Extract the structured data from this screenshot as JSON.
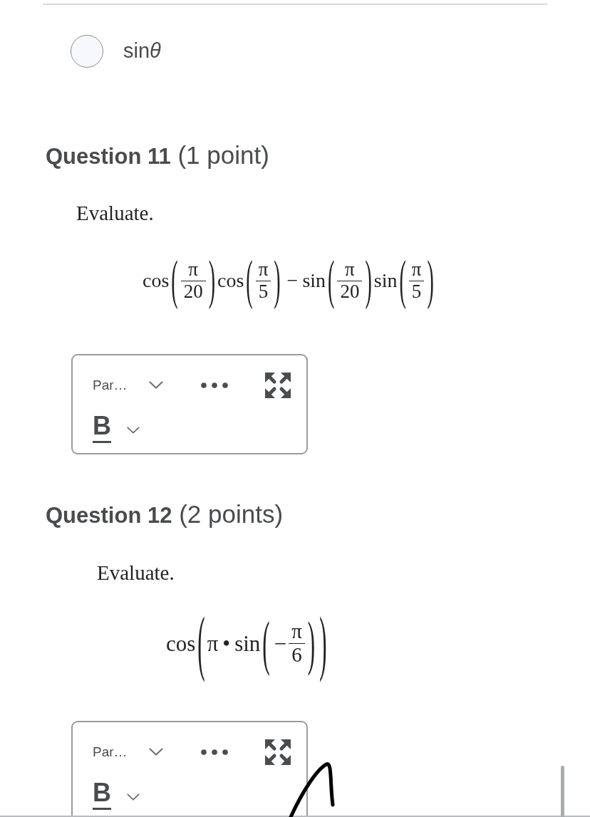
{
  "answer_options": [
    {
      "label": "sin",
      "variable": "θ",
      "selected": false
    }
  ],
  "questions": [
    {
      "heading": "**Question 11** (1 point)",
      "prompt": "Evaluate.",
      "expression": [
        {
          "kind": "fn",
          "text": "cos"
        },
        {
          "kind": "group",
          "open": "(",
          "close": ")",
          "items": [
            {
              "kind": "frac",
              "num": "π",
              "den": "20"
            }
          ]
        },
        {
          "kind": "fn",
          "text": "cos"
        },
        {
          "kind": "group",
          "open": "(",
          "close": ")",
          "items": [
            {
              "kind": "frac",
              "num": "π",
              "den": "5"
            }
          ]
        },
        {
          "kind": "op",
          "text": "−"
        },
        {
          "kind": "fn",
          "text": "sin"
        },
        {
          "kind": "group",
          "open": "(",
          "close": ")",
          "items": [
            {
              "kind": "frac",
              "num": "π",
              "den": "20"
            }
          ]
        },
        {
          "kind": "fn",
          "text": "sin"
        },
        {
          "kind": "group",
          "open": "(",
          "close": ")",
          "items": [
            {
              "kind": "frac",
              "num": "π",
              "den": "5"
            }
          ]
        }
      ],
      "editor": {
        "format_label": "Par…",
        "bold_label": "B"
      }
    },
    {
      "heading": "**Question 12** (2 points)",
      "prompt": "Evaluate.",
      "expression": [
        {
          "kind": "fn",
          "text": "cos"
        },
        {
          "kind": "group",
          "open": "(",
          "close": ")",
          "items": [
            {
              "kind": "sym",
              "text": "π"
            },
            {
              "kind": "op",
              "text": "•"
            },
            {
              "kind": "fn",
              "text": "sin"
            },
            {
              "kind": "group",
              "open": "(",
              "close": ")",
              "items": [
                {
                  "kind": "sign",
                  "text": "−"
                },
                {
                  "kind": "frac",
                  "num": "π",
                  "den": "6"
                }
              ]
            }
          ]
        }
      ],
      "editor": {
        "format_label": "Par…",
        "bold_label": "B"
      }
    }
  ]
}
